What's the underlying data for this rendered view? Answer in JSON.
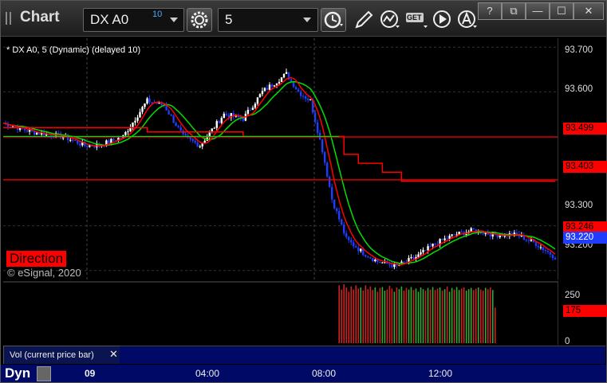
{
  "app": {
    "title": "Chart"
  },
  "toolbar": {
    "symbol": "DX A0",
    "symbol_count": "10",
    "interval": "5",
    "get_label": "GET"
  },
  "window_buttons": {
    "help": "?",
    "restore": "⧉",
    "min": "—",
    "max": "☐",
    "close": "✕"
  },
  "chart": {
    "label": "* DX A0, 5 (Dynamic) (delayed 10)",
    "direction_label": "Direction",
    "copyright": "© eSignal, 2020",
    "volume_study_tab": "Vol (current price bar)",
    "dyn_label": "Dyn",
    "colors": {
      "red_line": "#ff0000",
      "green_line": "#00e000",
      "up_candle": "#ffffff",
      "down_candle": "#1f3cff",
      "vol_up": "#33aa33",
      "vol_down": "#cc2222"
    }
  },
  "chart_data": {
    "type": "candlestick",
    "title": "",
    "price_axis": {
      "ticks": [
        "93.700",
        "93.600",
        "93.300",
        "93.200"
      ],
      "range": [
        93.18,
        93.72
      ]
    },
    "price_plates": [
      {
        "label": "93.499",
        "value": 93.499,
        "color": "#ff0000"
      },
      {
        "label": "93.403",
        "value": 93.403,
        "color": "#ff0000"
      },
      {
        "label": "93.246",
        "value": 93.246,
        "color": "#ff0000"
      },
      {
        "label": "93.220",
        "value": 93.22,
        "color": "#1f3cff"
      }
    ],
    "volume_axis": {
      "ticks": [
        "250",
        "0"
      ],
      "range": [
        0,
        300
      ]
    },
    "volume_plate": {
      "label": "175",
      "value": 175,
      "color": "#ff0000"
    },
    "time_axis": {
      "ticks": [
        "09",
        "04:00",
        "08:00",
        "12:00"
      ]
    },
    "series": [
      {
        "id": "price",
        "anchors": [
          [
            0,
            93.53
          ],
          [
            12,
            93.51
          ],
          [
            25,
            93.5
          ],
          [
            34,
            93.48
          ],
          [
            40,
            93.48
          ],
          [
            50,
            93.5
          ],
          [
            60,
            93.58
          ],
          [
            67,
            93.57
          ],
          [
            75,
            93.5
          ],
          [
            82,
            93.48
          ],
          [
            92,
            93.55
          ],
          [
            100,
            93.54
          ],
          [
            108,
            93.6
          ],
          [
            118,
            93.64
          ],
          [
            123,
            93.6
          ],
          [
            128,
            93.58
          ],
          [
            133,
            93.47
          ],
          [
            137,
            93.36
          ],
          [
            143,
            93.27
          ],
          [
            150,
            93.24
          ],
          [
            156,
            93.22
          ],
          [
            164,
            93.21
          ],
          [
            172,
            93.23
          ],
          [
            180,
            93.26
          ],
          [
            188,
            93.28
          ],
          [
            196,
            93.29
          ],
          [
            205,
            93.28
          ],
          [
            214,
            93.28
          ],
          [
            222,
            93.26
          ],
          [
            230,
            93.23
          ]
        ]
      },
      {
        "id": "red-stair",
        "points": [
          [
            0,
            93.52
          ],
          [
            60,
            93.52
          ],
          [
            60,
            93.51
          ],
          [
            100,
            93.51
          ],
          [
            100,
            93.5
          ],
          [
            133,
            93.5
          ],
          [
            133,
            93.5
          ],
          [
            142,
            93.5
          ],
          [
            142,
            93.46
          ],
          [
            148,
            93.46
          ],
          [
            148,
            93.44
          ],
          [
            158,
            93.44
          ],
          [
            158,
            93.42
          ],
          [
            166,
            93.42
          ],
          [
            166,
            93.4
          ],
          [
            230,
            93.4
          ]
        ]
      },
      {
        "id": "red-smooth",
        "window": 6
      },
      {
        "id": "green-smooth",
        "window": 12
      }
    ],
    "volume_start_index": 140,
    "volume_values": [
      280,
      260,
      285,
      270,
      250,
      275,
      260,
      280,
      265,
      270,
      255,
      280,
      262,
      275,
      258,
      270,
      250,
      268,
      272,
      255,
      260,
      278,
      265,
      250,
      270,
      262,
      275,
      255,
      268,
      260,
      272,
      258,
      265,
      250,
      270,
      262,
      255,
      268,
      260,
      272,
      258,
      265,
      270,
      255,
      262,
      275,
      250,
      268,
      260,
      272,
      258,
      265,
      270,
      255,
      262,
      268,
      258,
      265,
      270,
      260,
      255,
      268,
      262,
      270,
      258,
      175
    ]
  }
}
